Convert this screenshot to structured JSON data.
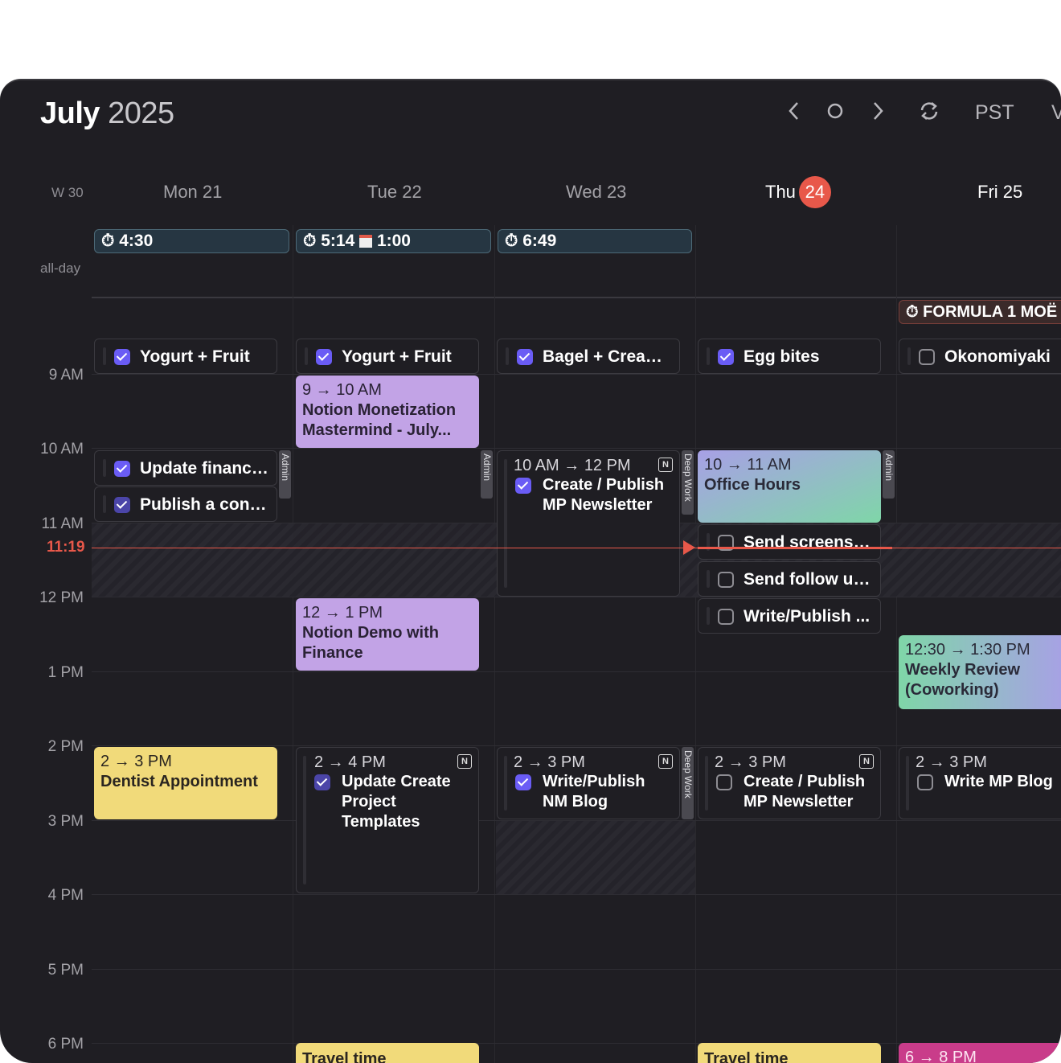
{
  "header": {
    "month": "July",
    "year": "2025",
    "timezone": "PST",
    "view_partial": "V"
  },
  "week_label": "W 30",
  "allday_label": "all-day",
  "days": [
    {
      "label": "Mon 21"
    },
    {
      "label": "Tue 22"
    },
    {
      "label": "Wed 23"
    },
    {
      "label": "Thu",
      "num": "24"
    },
    {
      "label": "Fri 25"
    }
  ],
  "hours": [
    "9 AM",
    "10 AM",
    "11 AM",
    "12 PM",
    "1 PM",
    "2 PM",
    "3 PM",
    "4 PM",
    "5 PM",
    "6 PM"
  ],
  "now_label": "11:19",
  "allday": {
    "mon_timer": "4:30",
    "tue_timer": "5:14",
    "tue_timer2": "1:00",
    "wed_timer": "6:49",
    "fri_event": "FORMULA 1 MOË"
  },
  "chips": {
    "mon_breakfast": "Yogurt + Fruit",
    "tue_breakfast": "Yogurt + Fruit",
    "wed_breakfast": "Bagel + Cream...",
    "thu_breakfast": "Egg bites",
    "fri_breakfast": "Okonomiyaki",
    "mon_task1": "Update financi...",
    "mon_task2": "Publish a conv...",
    "thu_task1": "Send screensh...",
    "thu_task2": "Send follow up...",
    "thu_task3": "Write/Publish ..."
  },
  "tags": {
    "admin": "Admin",
    "deep": "Deep Work"
  },
  "events": {
    "tue_notion_time": "9 → 10 AM",
    "tue_notion_name": "Notion Monetization Mastermind - July...",
    "wed_newsletter_time": "10 AM → 12 PM",
    "wed_newsletter_name": "Create / Publish MP Newsletter",
    "thu_office_time": "10 → 11 AM",
    "thu_office_name": "Office Hours",
    "tue_demo_time": "12 → 1 PM",
    "tue_demo_name": "Notion Demo with Finance",
    "fri_review_time": "12:30 → 1:30 PM",
    "fri_review_name": "Weekly Review (Coworking)",
    "mon_dentist_time": "2 → 3 PM",
    "mon_dentist_name": "Dentist Appointment",
    "tue_templates_time": "2 → 4 PM",
    "tue_templates_name": "Update Create Project Templates",
    "wed_blog_time": "2 → 3 PM",
    "wed_blog_name": "Write/Publish NM Blog",
    "thu_newsletter_time": "2 → 3 PM",
    "thu_newsletter_name": "Create / Publish MP Newsletter",
    "fri_blog_time": "2 → 3 PM",
    "fri_blog_name": "Write MP Blog",
    "tue_travel": "Travel time",
    "thu_travel": "Travel time",
    "fri_evening_time": "6 → 8 PM"
  },
  "colors": {
    "accent": "#6a5cf5",
    "today": "#e8584a",
    "now_line": "#e8584a",
    "purple_event": "#c2a3e6",
    "yellow_event": "#f1da7a"
  }
}
